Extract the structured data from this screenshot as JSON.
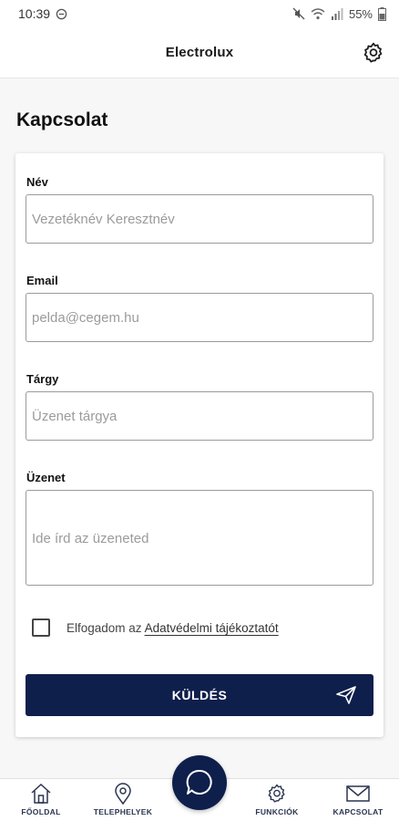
{
  "status_bar": {
    "time": "10:39",
    "battery": "55%"
  },
  "header": {
    "title": "Electrolux"
  },
  "page": {
    "title": "Kapcsolat"
  },
  "form": {
    "name": {
      "label": "Név",
      "placeholder": "Vezetéknév Keresztnév",
      "value": ""
    },
    "email": {
      "label": "Email",
      "placeholder": "pelda@cegem.hu",
      "value": ""
    },
    "subject": {
      "label": "Tárgy",
      "placeholder": "Üzenet tárgya",
      "value": ""
    },
    "message": {
      "label": "Üzenet",
      "placeholder": "Ide írd az üzeneted",
      "value": ""
    },
    "consent": {
      "text": "Elfogadom az",
      "link": "Adatvédelmi tájékoztatót",
      "checked": false
    },
    "submit_label": "KÜLDÉS"
  },
  "bottom_nav": {
    "items": [
      {
        "label": "FŐOLDAL",
        "icon": "home-icon"
      },
      {
        "label": "TELEPHELYEK",
        "icon": "location-pin-icon"
      },
      {
        "label": "FUNKCIÓK",
        "icon": "gear-icon"
      },
      {
        "label": "KAPCSOLAT",
        "icon": "mail-icon"
      }
    ],
    "center_action_icon": "chat-bubble-icon"
  },
  "colors": {
    "primary": "#0f1f4b",
    "background": "#f7f7f7"
  }
}
